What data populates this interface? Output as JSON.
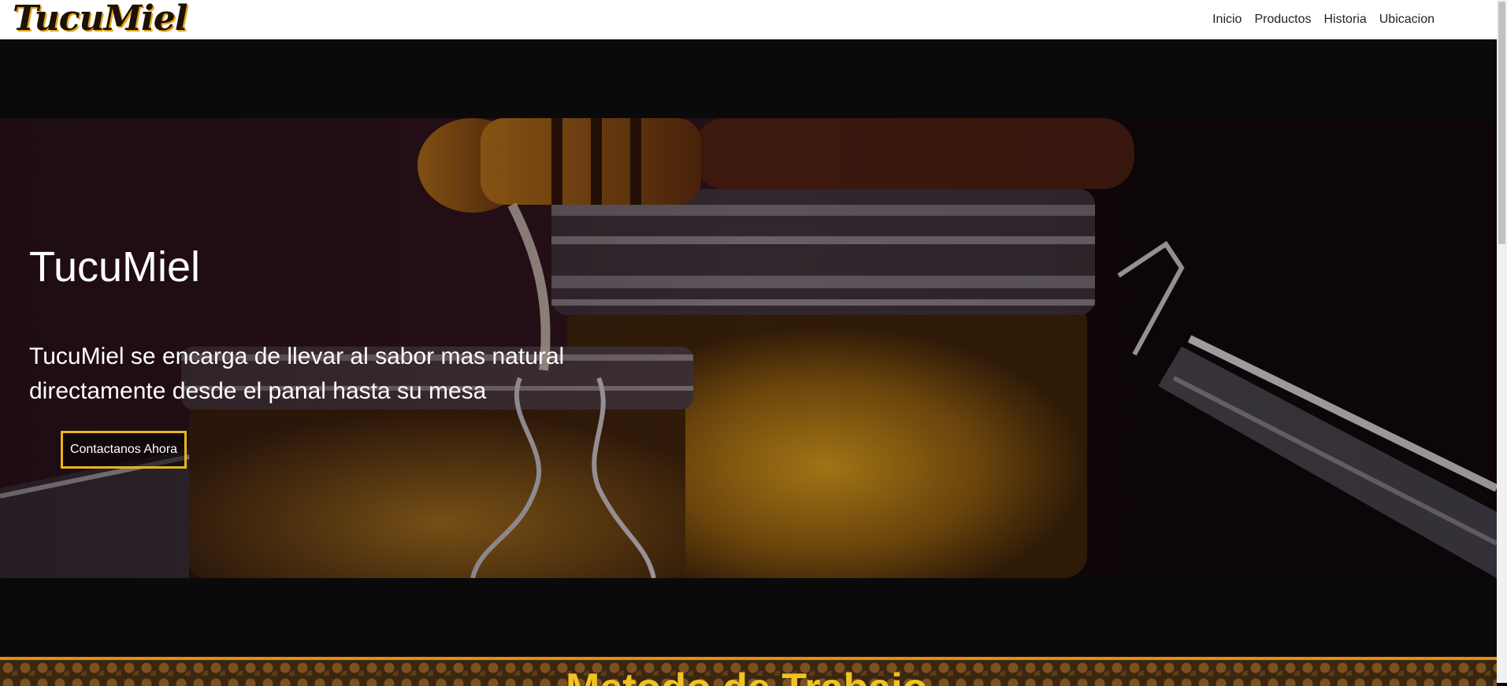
{
  "brand": {
    "name": "TucuMiel"
  },
  "nav": {
    "items": [
      "Inicio",
      "Productos",
      "Historia",
      "Ubicacion"
    ]
  },
  "hero": {
    "title": "TucuMiel",
    "text": "TucuMiel se encarga de llevar al sabor mas natural directamente desde el panal hasta su mesa",
    "button_label": "Contactanos Ahora"
  },
  "next_section": {
    "title_partial": "Metodo de Trabajo"
  },
  "colors": {
    "accent": "#e8b51c",
    "brand_gold": "#e8a417",
    "dark_bg": "#0a0a0a",
    "section_border": "#e88a12"
  },
  "icons": {
    "honey_dipper": "honey-dipper-illustration",
    "jars": "honey-jar-illustration"
  }
}
